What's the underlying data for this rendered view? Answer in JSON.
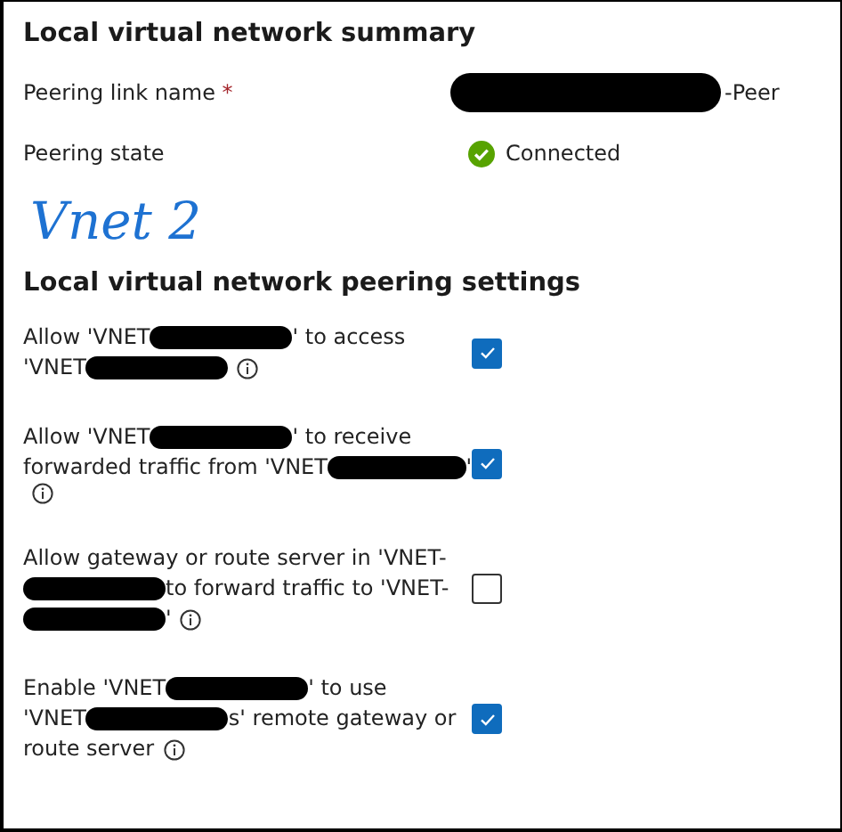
{
  "summary": {
    "title": "Local virtual network summary",
    "fields": [
      {
        "label": "Peering link name",
        "required_mark": "*",
        "kind": "redacted",
        "value": "-Peer"
      },
      {
        "label": "Peering state",
        "kind": "status",
        "value": "Connected"
      }
    ]
  },
  "annotation": "Vnet 2",
  "settings": {
    "title": "Local virtual network peering settings",
    "items": [
      {
        "checked": true,
        "lines": [
          [
            {
              "kind": "text",
              "text": "Allow 'VNET"
            },
            {
              "kind": "redaction"
            },
            {
              "kind": "text",
              "text": "' to access"
            }
          ],
          [
            {
              "kind": "text",
              "text": "'VNET"
            },
            {
              "kind": "redaction"
            },
            {
              "kind": "info"
            }
          ]
        ]
      },
      {
        "checked": true,
        "lines": [
          [
            {
              "kind": "text",
              "text": "Allow 'VNET"
            },
            {
              "kind": "redaction"
            },
            {
              "kind": "text",
              "text": "' to receive"
            }
          ],
          [
            {
              "kind": "text",
              "text": "forwarded traffic from 'VNET"
            },
            {
              "kind": "redaction"
            },
            {
              "kind": "text",
              "text": "'"
            }
          ],
          [
            {
              "kind": "info"
            }
          ]
        ]
      },
      {
        "checked": false,
        "lines": [
          [
            {
              "kind": "text",
              "text": "Allow gateway or route server in 'VNET-"
            }
          ],
          [
            {
              "kind": "redaction"
            },
            {
              "kind": "text",
              "text": " to forward traffic to 'VNET-"
            }
          ],
          [
            {
              "kind": "redaction"
            },
            {
              "kind": "text",
              "text": "'"
            },
            {
              "kind": "info"
            }
          ]
        ]
      },
      {
        "checked": true,
        "lines": [
          [
            {
              "kind": "text",
              "text": "Enable 'VNET"
            },
            {
              "kind": "redaction"
            },
            {
              "kind": "text",
              "text": "' to use"
            }
          ],
          [
            {
              "kind": "text",
              "text": "'VNET"
            },
            {
              "kind": "redaction"
            },
            {
              "kind": "text",
              "text": "s' remote gateway or"
            }
          ],
          [
            {
              "kind": "text",
              "text": "route server"
            },
            {
              "kind": "info"
            }
          ]
        ]
      }
    ]
  }
}
